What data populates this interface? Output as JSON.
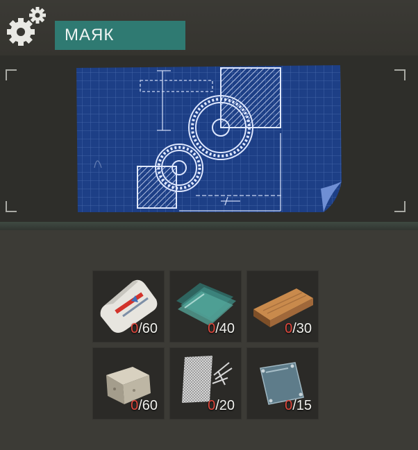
{
  "header": {
    "title": "МАЯК",
    "icon": "gears-icon"
  },
  "preview": {
    "image": "blueprint-gears",
    "colors": {
      "paper": "#1d3f86",
      "lines": "#dfe8ff"
    }
  },
  "resources": [
    {
      "name": "cement-bag",
      "icon": "cement-bag-icon",
      "have": "0",
      "need": "/60"
    },
    {
      "name": "glass-sheets",
      "icon": "glass-icon",
      "have": "0",
      "need": "/40"
    },
    {
      "name": "wood-plank",
      "icon": "plank-icon",
      "have": "0",
      "need": "/30"
    },
    {
      "name": "stone-block",
      "icon": "stone-icon",
      "have": "0",
      "need": "/60"
    },
    {
      "name": "mesh-wire",
      "icon": "mesh-icon",
      "have": "0",
      "need": "/20"
    },
    {
      "name": "metal-plate",
      "icon": "plate-icon",
      "have": "0",
      "need": "/15"
    }
  ],
  "colors": {
    "have_missing": "#e0473c",
    "title_bg": "#2f7a72"
  }
}
